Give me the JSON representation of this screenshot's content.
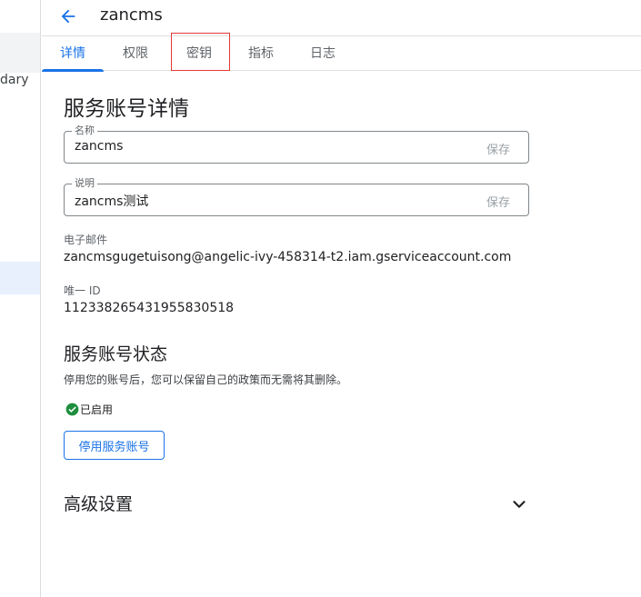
{
  "sidebar": {
    "cut_text": "dary"
  },
  "header": {
    "title": "zancms"
  },
  "tabs": [
    {
      "label": "详情",
      "active": true
    },
    {
      "label": "权限",
      "active": false
    },
    {
      "label": "密钥",
      "active": false
    },
    {
      "label": "指标",
      "active": false
    },
    {
      "label": "日志",
      "active": false
    }
  ],
  "details": {
    "title": "服务账号详情",
    "name_field": {
      "label": "名称",
      "value": "zancms",
      "save_label": "保存"
    },
    "desc_field": {
      "label": "说明",
      "value": "zancms测试",
      "save_label": "保存"
    },
    "email_label": "电子邮件",
    "email_value": "zancmsgugetuisong@angelic-ivy-458314-t2.iam.gserviceaccount.com",
    "uid_label": "唯一 ID",
    "uid_value": "112338265431955830518"
  },
  "status": {
    "title": "服务账号状态",
    "note": "停用您的账号后，您可以保留自己的政策而无需将其删除。",
    "state_text": "已启用",
    "disable_button": "停用服务账号"
  },
  "advanced": {
    "title": "高级设置"
  },
  "colors": {
    "accent": "#1a73e8",
    "success": "#1e8e3e",
    "highlight_box": "#e53935"
  }
}
